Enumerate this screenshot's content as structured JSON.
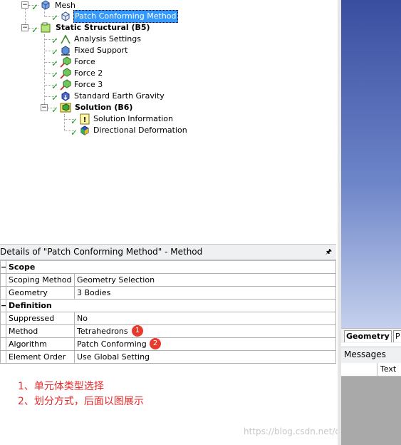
{
  "tree": {
    "nodes": [
      {
        "label": "Mesh",
        "bold": false,
        "selected": false,
        "icon": "mesh-icon"
      },
      {
        "label": "Patch Conforming Method",
        "bold": false,
        "selected": true,
        "icon": "mesh-method-icon"
      },
      {
        "label": "Static Structural (B5)",
        "bold": true,
        "selected": false,
        "icon": "static-structural-icon"
      },
      {
        "label": "Analysis Settings",
        "bold": false,
        "selected": false,
        "icon": "analysis-settings-icon"
      },
      {
        "label": "Fixed Support",
        "bold": false,
        "selected": false,
        "icon": "fixed-support-icon"
      },
      {
        "label": "Force",
        "bold": false,
        "selected": false,
        "icon": "force-icon"
      },
      {
        "label": "Force 2",
        "bold": false,
        "selected": false,
        "icon": "force-icon"
      },
      {
        "label": "Force 3",
        "bold": false,
        "selected": false,
        "icon": "force-icon"
      },
      {
        "label": "Standard Earth Gravity",
        "bold": false,
        "selected": false,
        "icon": "gravity-icon"
      },
      {
        "label": "Solution (B6)",
        "bold": true,
        "selected": false,
        "icon": "solution-icon"
      },
      {
        "label": "Solution Information",
        "bold": false,
        "selected": false,
        "icon": "solution-info-icon"
      },
      {
        "label": "Directional Deformation",
        "bold": false,
        "selected": false,
        "icon": "deformation-icon"
      }
    ]
  },
  "details": {
    "title": "Details of \"Patch Conforming Method\" - Method",
    "pin_icon": "pin-icon",
    "sections": [
      {
        "name": "Scope",
        "rows": [
          {
            "label": "Scoping Method",
            "value": "Geometry Selection"
          },
          {
            "label": "Geometry",
            "value": "3 Bodies"
          }
        ]
      },
      {
        "name": "Definition",
        "rows": [
          {
            "label": "Suppressed",
            "value": "No"
          },
          {
            "label": "Method",
            "value": "Tetrahedrons"
          },
          {
            "label": "Algorithm",
            "value": "Patch Conforming"
          },
          {
            "label": "Element Order",
            "value": "Use Global Setting"
          }
        ]
      }
    ],
    "badges": [
      "1",
      "2"
    ]
  },
  "notes": [
    "1、单元体类型选择",
    "2、划分方式，后面以图展示"
  ],
  "watermark": "https://blog.csdn.net/caijifeizai",
  "view_tabs": {
    "geometry": "Geometry",
    "partial": "P"
  },
  "messages": {
    "title": "Messages",
    "col_text": "Text"
  },
  "colors": {
    "selection": "#3399ff",
    "check": "#1a9c1a",
    "badge": "#e63b2e",
    "note": "#e5292a"
  }
}
